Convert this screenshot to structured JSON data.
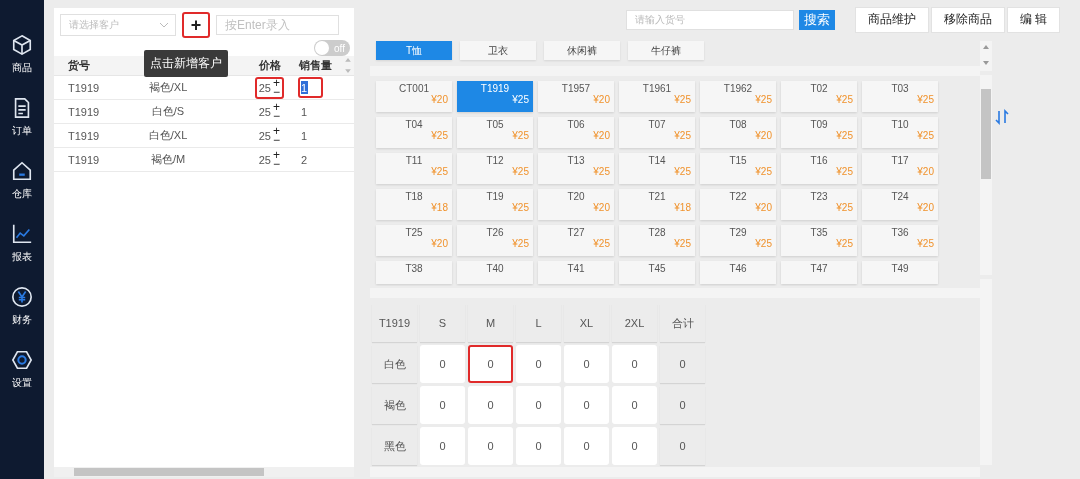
{
  "sidebar": {
    "items": [
      {
        "label": "商品"
      },
      {
        "label": "订单"
      },
      {
        "label": "仓库"
      },
      {
        "label": "报表"
      },
      {
        "label": "财务"
      },
      {
        "label": "设置"
      }
    ]
  },
  "order": {
    "customer_select": {
      "placeholder": "请选择客户"
    },
    "add_button": {
      "label": "+",
      "highlighted": true
    },
    "entry_field": {
      "placeholder": "按Enter录入"
    },
    "tooltip": "点击新增客户",
    "toggle": {
      "label": "off",
      "on": false
    },
    "columns": [
      "货号",
      "价格",
      "销售量"
    ],
    "rows": [
      {
        "code": "T1919",
        "detail": "褐色/XL",
        "price": "25",
        "qty": "1",
        "price_highlighted": true,
        "qty_highlighted": true,
        "qty_selected": true
      },
      {
        "code": "T1919",
        "detail": "白色/S",
        "price": "25",
        "qty": "1",
        "price_highlighted": false,
        "qty_highlighted": false,
        "qty_selected": false
      },
      {
        "code": "T1919",
        "detail": "白色/XL",
        "price": "25",
        "qty": "1",
        "price_highlighted": false,
        "qty_highlighted": false,
        "qty_selected": false
      },
      {
        "code": "T1919",
        "detail": "褐色/M",
        "price": "25",
        "qty": "2",
        "price_highlighted": false,
        "qty_highlighted": false,
        "qty_selected": false
      }
    ],
    "stepper": {
      "plus": "+",
      "minus": "−"
    }
  },
  "toolbar": {
    "search": {
      "placeholder": "请输入货号"
    },
    "search_button": "搜索",
    "buttons": [
      "商品维护",
      "移除商品",
      "编 辑"
    ]
  },
  "category_tabs": [
    {
      "label": "T恤",
      "selected": true
    },
    {
      "label": "卫衣",
      "selected": false
    },
    {
      "label": "休闲裤",
      "selected": false
    },
    {
      "label": "牛仔裤",
      "selected": false
    }
  ],
  "products": [
    {
      "code": "CT001",
      "price": "¥20",
      "selected": false
    },
    {
      "code": "T1919",
      "price": "¥25",
      "selected": true
    },
    {
      "code": "T1957",
      "price": "¥20",
      "selected": false
    },
    {
      "code": "T1961",
      "price": "¥25",
      "selected": false
    },
    {
      "code": "T1962",
      "price": "¥25",
      "selected": false
    },
    {
      "code": "T02",
      "price": "¥25",
      "selected": false
    },
    {
      "code": "T03",
      "price": "¥25",
      "selected": false
    },
    {
      "code": "T04",
      "price": "¥25",
      "selected": false
    },
    {
      "code": "T05",
      "price": "¥25",
      "selected": false
    },
    {
      "code": "T06",
      "price": "¥20",
      "selected": false
    },
    {
      "code": "T07",
      "price": "¥25",
      "selected": false
    },
    {
      "code": "T08",
      "price": "¥20",
      "selected": false
    },
    {
      "code": "T09",
      "price": "¥25",
      "selected": false
    },
    {
      "code": "T10",
      "price": "¥25",
      "selected": false
    },
    {
      "code": "T11",
      "price": "¥25",
      "selected": false
    },
    {
      "code": "T12",
      "price": "¥25",
      "selected": false
    },
    {
      "code": "T13",
      "price": "¥25",
      "selected": false
    },
    {
      "code": "T14",
      "price": "¥25",
      "selected": false
    },
    {
      "code": "T15",
      "price": "¥25",
      "selected": false
    },
    {
      "code": "T16",
      "price": "¥25",
      "selected": false
    },
    {
      "code": "T17",
      "price": "¥20",
      "selected": false
    },
    {
      "code": "T18",
      "price": "¥18",
      "selected": false
    },
    {
      "code": "T19",
      "price": "¥25",
      "selected": false
    },
    {
      "code": "T20",
      "price": "¥20",
      "selected": false
    },
    {
      "code": "T21",
      "price": "¥18",
      "selected": false
    },
    {
      "code": "T22",
      "price": "¥20",
      "selected": false
    },
    {
      "code": "T23",
      "price": "¥25",
      "selected": false
    },
    {
      "code": "T24",
      "price": "¥20",
      "selected": false
    },
    {
      "code": "T25",
      "price": "¥20",
      "selected": false
    },
    {
      "code": "T26",
      "price": "¥25",
      "selected": false
    },
    {
      "code": "T27",
      "price": "¥25",
      "selected": false
    },
    {
      "code": "T28",
      "price": "¥25",
      "selected": false
    },
    {
      "code": "T29",
      "price": "¥25",
      "selected": false
    },
    {
      "code": "T35",
      "price": "¥25",
      "selected": false
    },
    {
      "code": "T36",
      "price": "¥25",
      "selected": false
    },
    {
      "code": "T38",
      "selected": false
    },
    {
      "code": "T40",
      "selected": false
    },
    {
      "code": "T41",
      "selected": false
    },
    {
      "code": "T45",
      "selected": false
    },
    {
      "code": "T46",
      "selected": false
    },
    {
      "code": "T47",
      "selected": false
    },
    {
      "code": "T49",
      "selected": false
    }
  ],
  "size_matrix": {
    "headers": [
      "T1919",
      "S",
      "M",
      "L",
      "XL",
      "2XL",
      "合计"
    ],
    "rows": [
      {
        "label": "白色",
        "cells": [
          {
            "value": "0",
            "highlighted": false
          },
          {
            "value": "0",
            "highlighted": true
          },
          {
            "value": "0",
            "highlighted": false
          },
          {
            "value": "0",
            "highlighted": false
          },
          {
            "value": "0",
            "highlighted": false
          }
        ],
        "total": "0"
      },
      {
        "label": "褐色",
        "cells": [
          {
            "value": "0",
            "highlighted": false
          },
          {
            "value": "0",
            "highlighted": false
          },
          {
            "value": "0",
            "highlighted": false
          },
          {
            "value": "0",
            "highlighted": false
          },
          {
            "value": "0",
            "highlighted": false
          }
        ],
        "total": "0"
      },
      {
        "label": "黑色",
        "cells": [
          {
            "value": "0",
            "highlighted": false
          },
          {
            "value": "0",
            "highlighted": false
          },
          {
            "value": "0",
            "highlighted": false
          },
          {
            "value": "0",
            "highlighted": false
          },
          {
            "value": "0",
            "highlighted": false
          }
        ],
        "total": "0"
      }
    ]
  }
}
